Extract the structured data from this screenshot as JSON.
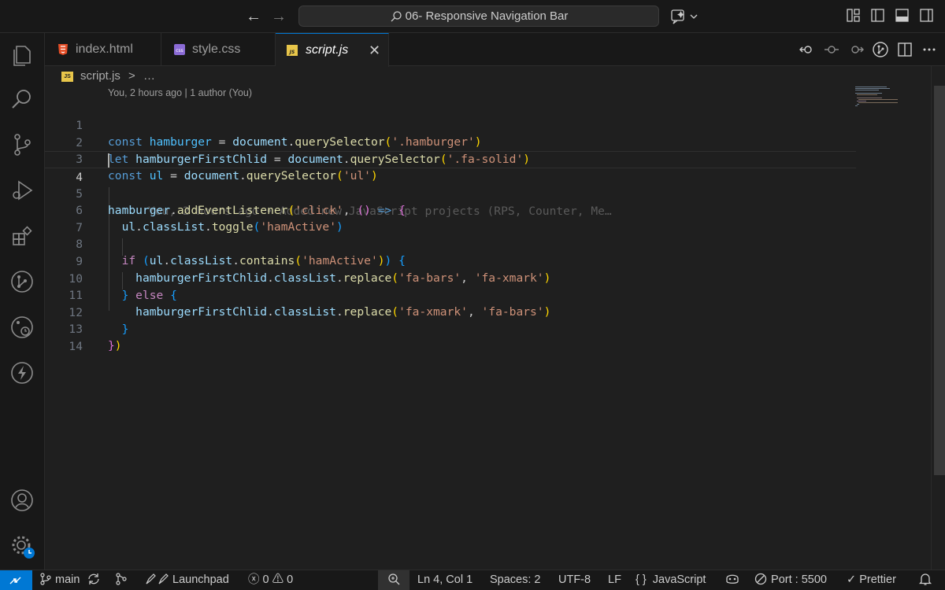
{
  "titlebar": {
    "search_text": "06- Responsive Navigation Bar"
  },
  "tabs": [
    {
      "label": "index.html",
      "icon": "html5-icon",
      "color": "#e44d26"
    },
    {
      "label": "style.css",
      "icon": "css-icon",
      "color": "#8b6bd6"
    },
    {
      "label": "script.js",
      "icon": "js-icon",
      "color": "#e8c64a",
      "active": true,
      "close": "✕"
    }
  ],
  "breadcrumb": {
    "file": "script.js",
    "separator": ">",
    "rest": "…",
    "badge": "JS"
  },
  "editor": {
    "codelens": "You, 2 hours ago | 1 author (You)",
    "blame_text": "You, 2 hours ago • Added new JavaScript projects (RPS, Counter, Me…",
    "line_numbers": [
      "1",
      "2",
      "3",
      "4",
      "5",
      "6",
      "7",
      "8",
      "9",
      "10",
      "11",
      "12",
      "13",
      "14"
    ],
    "lines": [
      "const hamburger = document.querySelector('.hamburger')",
      "let hamburgerFirstChlid = document.querySelector('.fa-solid')",
      "const ul = document.querySelector('ul')",
      "",
      "hamburger.addEventListener('click', () => {",
      "  ul.classList.toggle('hamActive')",
      "",
      "  if (ul.classList.contains('hamActive')) {",
      "    hamburgerFirstChlid.classList.replace('fa-bars', 'fa-xmark')",
      "  } else {",
      "    hamburgerFirstChlid.classList.replace('fa-xmark', 'fa-bars')",
      "  }",
      "})",
      ""
    ]
  },
  "statusbar": {
    "branch": "main",
    "launchpad": "Launchpad",
    "errors": "0",
    "warnings": "0",
    "position": "Ln 4, Col 1",
    "spaces": "Spaces: 2",
    "encoding": "UTF-8",
    "eol": "LF",
    "language_braces": "{ }",
    "language": "JavaScript",
    "port": "Port : 5500",
    "prettier": "Prettier"
  },
  "colors": {
    "accent": "#0078d4",
    "background": "#1f1f1f",
    "chrome": "#181818"
  }
}
